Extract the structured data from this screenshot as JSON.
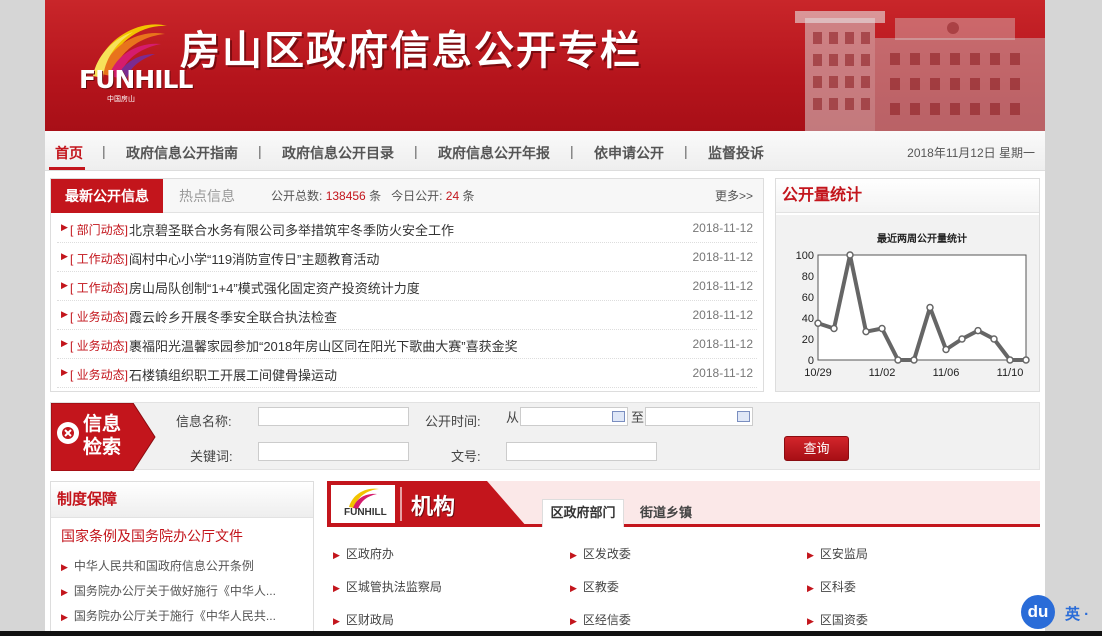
{
  "banner": {
    "logo_text": "FUNHILL",
    "logo_sub": "中国房山",
    "title": "房山区政府信息公开专栏"
  },
  "nav": {
    "items": [
      {
        "label": "首页",
        "active": true
      },
      {
        "label": "政府信息公开指南"
      },
      {
        "label": "政府信息公开目录"
      },
      {
        "label": "政府信息公开年报"
      },
      {
        "label": "依申请公开"
      },
      {
        "label": "监督投诉"
      }
    ],
    "separator": "|",
    "date": "2018年11月12日  星期一"
  },
  "news": {
    "tab_active": "最新公开信息",
    "tab_hot": "热点信息",
    "stat_total_label": "公开总数:",
    "stat_total": "138456",
    "stat_unit": "条",
    "stat_today_label": "今日公开:",
    "stat_today": "24",
    "more": "更多>>",
    "items": [
      {
        "cat": "[ 部门动态]",
        "title": "北京碧圣联合水务有限公司多举措筑牢冬季防火安全工作",
        "date": "2018-11-12"
      },
      {
        "cat": "[ 工作动态]",
        "title": "阎村中心小学“119消防宣传日”主题教育活动",
        "date": "2018-11-12"
      },
      {
        "cat": "[ 工作动态]",
        "title": "房山局队创制“1+4”模式强化固定资产投资统计力度",
        "date": "2018-11-12"
      },
      {
        "cat": "[ 业务动态]",
        "title": "霞云岭乡开展冬季安全联合执法检查",
        "date": "2018-11-12"
      },
      {
        "cat": "[ 业务动态]",
        "title": "裹福阳光温馨家园参加“2018年房山区同在阳光下歌曲大赛”喜获金奖",
        "date": "2018-11-12"
      },
      {
        "cat": "[ 业务动态]",
        "title": "石楼镇组织职工开展工间健骨操运动",
        "date": "2018-11-12"
      }
    ]
  },
  "stats": {
    "heading": "公开量统计",
    "chart_data": {
      "type": "line",
      "title": "最近两周公开量统计",
      "x": [
        "10/29",
        "10/30",
        "10/31",
        "11/01",
        "11/02",
        "11/03",
        "11/04",
        "11/05",
        "11/06",
        "11/07",
        "11/08",
        "11/09",
        "11/10",
        "11/11"
      ],
      "x_tick_labels": [
        "10/29",
        "11/02",
        "11/06",
        "11/10"
      ],
      "y_ticks": [
        0,
        20,
        40,
        60,
        80,
        100
      ],
      "ylim": [
        0,
        100
      ],
      "values": [
        35,
        30,
        100,
        27,
        30,
        0,
        0,
        50,
        10,
        20,
        28,
        20,
        0,
        0
      ],
      "grid": false,
      "color": "#666666"
    }
  },
  "search": {
    "badge_line1": "信息",
    "badge_line2": "检索",
    "name_label": "信息名称:",
    "time_label": "公开时间:",
    "from_label": "从",
    "to_label": "至",
    "keyword_label": "关键词:",
    "docno_label": "文号:",
    "query_button": "查询"
  },
  "system": {
    "heading": "制度保障",
    "sub": "国家条例及国务院办公厅文件",
    "items": [
      "中华人民共和国政府信息公开条例",
      "国务院办公厅关于做好施行《中华人...",
      "国务院办公厅关于施行《中华人民共..."
    ]
  },
  "org": {
    "logo_text": "FUNHILL",
    "title": "机构",
    "tab_active": "区政府部门",
    "tab_other": "街道乡镇",
    "rows": [
      [
        "区政府办",
        "区发改委",
        "区安监局"
      ],
      [
        "区城管执法监察局",
        "区教委",
        "区科委"
      ],
      [
        "区财政局",
        "区经信委",
        "区国资委"
      ]
    ]
  },
  "float": {
    "du": "du",
    "text": "英 ·"
  },
  "colors": {
    "brand_red": "#c3151c",
    "nav_bg": "#f3f3f3",
    "baidu_blue": "#2a6cd8"
  }
}
